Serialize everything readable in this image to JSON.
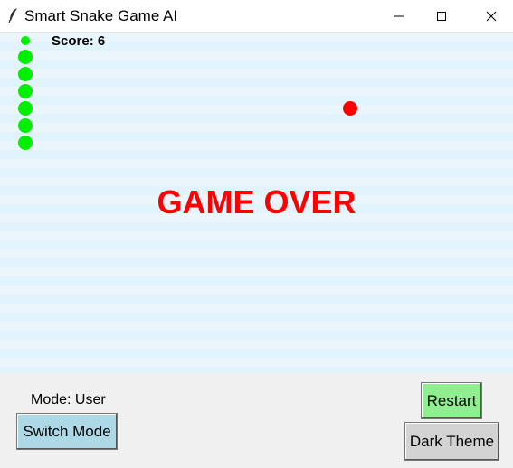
{
  "window": {
    "title": "Smart Snake Game AI",
    "icon": "feather-icon",
    "controls": [
      "minimize-icon",
      "maximize-icon",
      "close-icon"
    ]
  },
  "game": {
    "score_text": "Score: 6",
    "status_text": "GAME OVER",
    "background_colors": [
      "#eaf6fc",
      "#e1f3fc"
    ],
    "snake_color": "#00ee00",
    "food_color": "#ff0000",
    "status_color": "#ff0000",
    "snake_length": 7
  },
  "controls": {
    "mode_label": "Mode: User",
    "switch_mode_label": "Switch Mode",
    "restart_label": "Restart",
    "theme_label": "Dark Theme",
    "switch_color": "#add8e6",
    "restart_color": "#90ee90",
    "theme_color": "#d3d3d3"
  }
}
